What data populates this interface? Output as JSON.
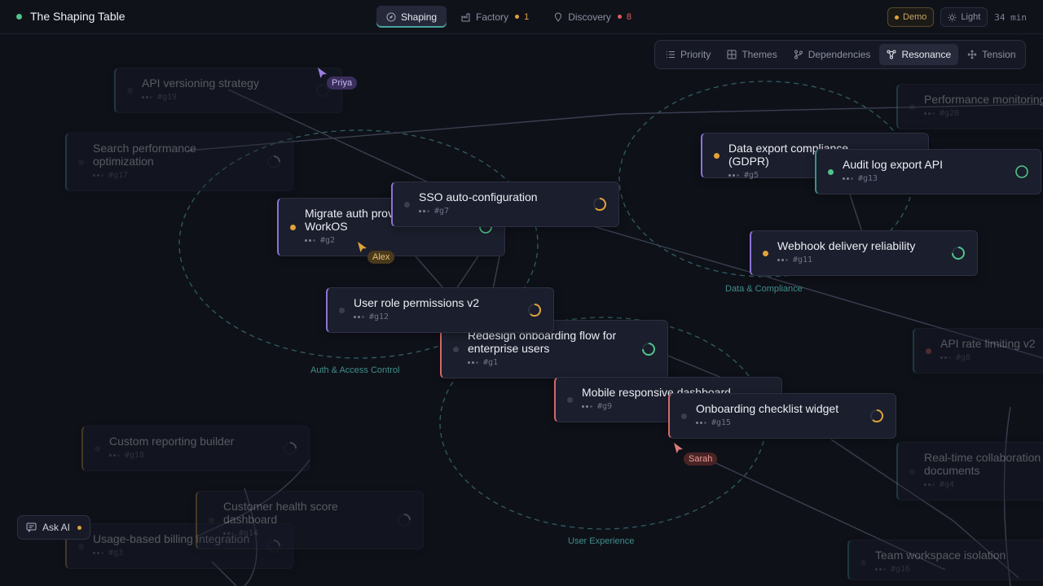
{
  "app": {
    "title": "The Shaping Table",
    "status_color": "#4fc48b"
  },
  "nav": [
    {
      "label": "Shaping",
      "icon": "compass-icon",
      "active": true
    },
    {
      "label": "Factory",
      "icon": "factory-icon",
      "count": "1",
      "count_color": "#e0a23b"
    },
    {
      "label": "Discovery",
      "icon": "pin-icon",
      "count": "8",
      "count_color": "#e05d5d"
    }
  ],
  "controls": {
    "demo": "Demo",
    "theme": "Light",
    "timer": "34 min"
  },
  "lenses": [
    {
      "label": "Priority",
      "icon": "list-icon"
    },
    {
      "label": "Themes",
      "icon": "grid-icon"
    },
    {
      "label": "Dependencies",
      "icon": "branch-icon"
    },
    {
      "label": "Resonance",
      "icon": "network-icon",
      "active": true
    },
    {
      "label": "Tension",
      "icon": "move-icon"
    }
  ],
  "clusters": [
    {
      "label": "Auth & Access Control"
    },
    {
      "label": "Data & Compliance"
    },
    {
      "label": "User Experience"
    }
  ],
  "cards": [
    {
      "id": "#g19",
      "title": "API versioning strategy"
    },
    {
      "id": "#g17",
      "title": "Search performance optimization"
    },
    {
      "id": "#g20",
      "title": "Performance monitoring"
    },
    {
      "id": "#g5",
      "title": "Data export compliance (GDPR)"
    },
    {
      "id": "#g13",
      "title": "Audit log export API"
    },
    {
      "id": "#g2",
      "title": "Migrate auth provider to WorkOS"
    },
    {
      "id": "#g7",
      "title": "SSO auto-configuration"
    },
    {
      "id": "#g11",
      "title": "Webhook delivery reliability"
    },
    {
      "id": "#g12",
      "title": "User role permissions v2"
    },
    {
      "id": "#g1",
      "title": "Redesign onboarding flow for enterprise users"
    },
    {
      "id": "#g8",
      "title": "API rate limiting v2"
    },
    {
      "id": "#g9",
      "title": "Mobile responsive dashboard"
    },
    {
      "id": "#g15",
      "title": "Onboarding checklist widget"
    },
    {
      "id": "#g18",
      "title": "Custom reporting builder"
    },
    {
      "id": "#g4",
      "title": "Real-time collaboration documents"
    },
    {
      "id": "#g14",
      "title": "Customer health score dashboard"
    },
    {
      "id": "#g3",
      "title": "Usage-based billing integration"
    },
    {
      "id": "#g16",
      "title": "Team workspace isolation"
    }
  ],
  "collaborators": [
    {
      "name": "Priya",
      "color": "#9a7ee0"
    },
    {
      "name": "Alex",
      "color": "#e0a23b"
    },
    {
      "name": "Sarah",
      "color": "#e07a7a"
    }
  ],
  "ask_ai": {
    "label": "Ask AI"
  }
}
